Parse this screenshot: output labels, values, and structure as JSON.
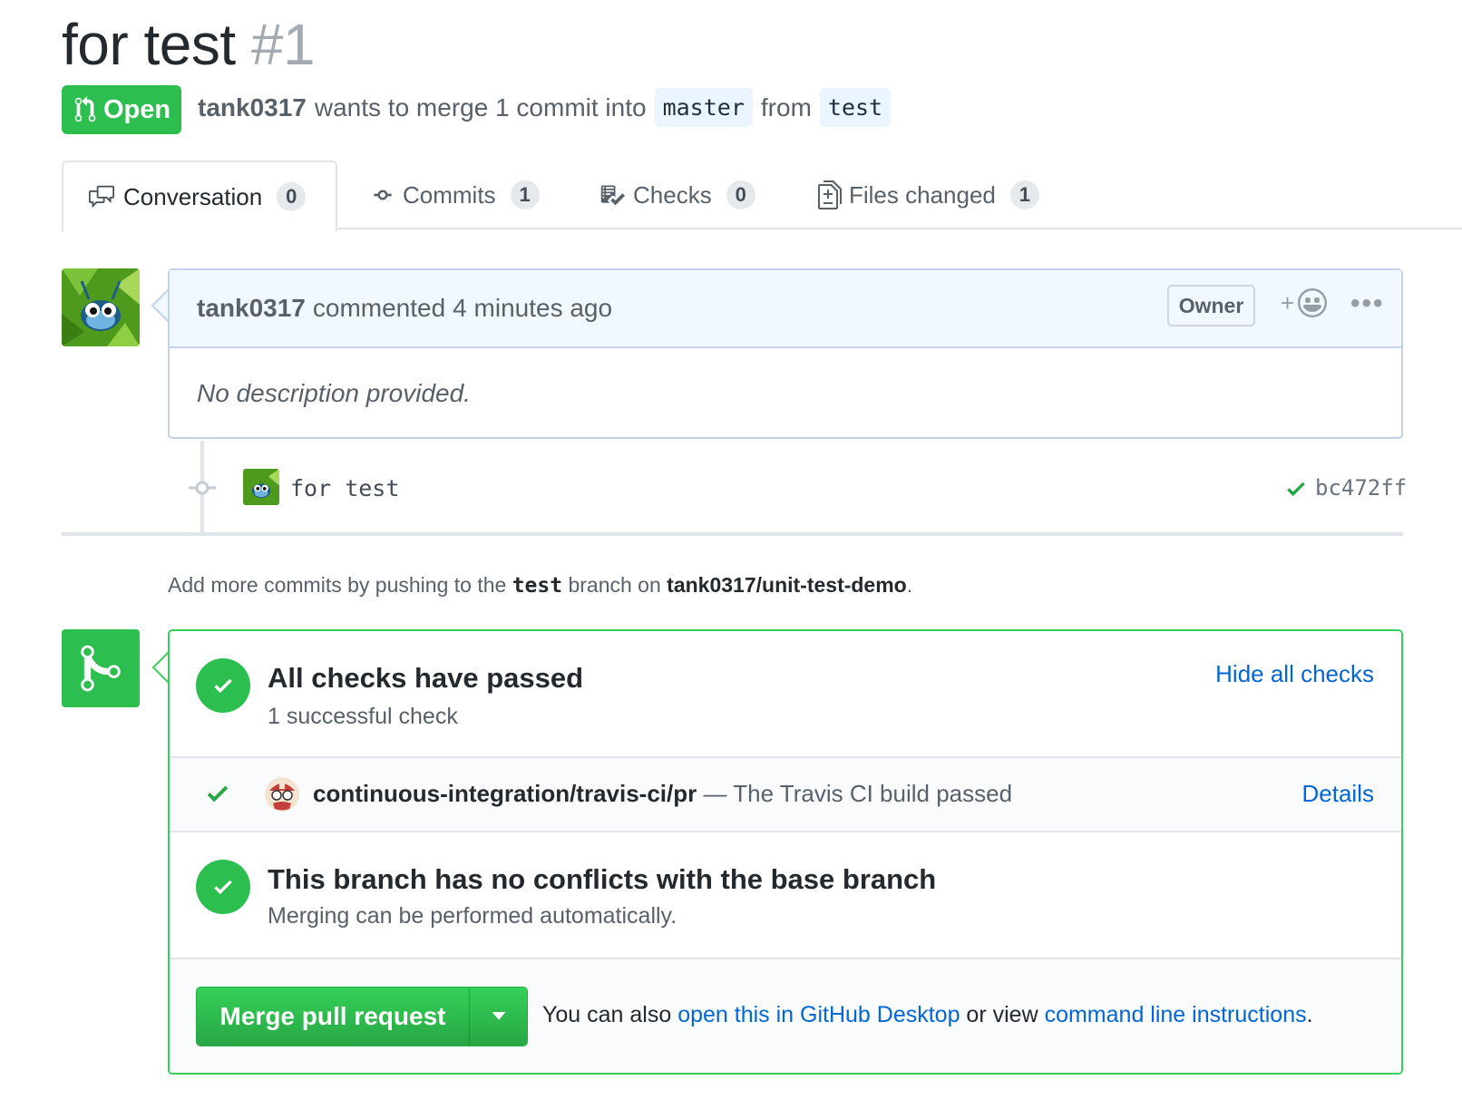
{
  "pr": {
    "title": "for test",
    "number": "#1",
    "state": "Open",
    "author": "tank0317",
    "summary": "wants to merge 1 commit into",
    "base_branch": "master",
    "from_word": "from",
    "head_branch": "test"
  },
  "tabs": [
    {
      "label": "Conversation",
      "count": "0",
      "icon": "conversation-icon",
      "selected": true
    },
    {
      "label": "Commits",
      "count": "1",
      "icon": "commit-icon"
    },
    {
      "label": "Checks",
      "count": "0",
      "icon": "checklist-icon"
    },
    {
      "label": "Files changed",
      "count": "1",
      "icon": "file-diff-icon"
    }
  ],
  "comment": {
    "author": "tank0317",
    "action": "commented",
    "time": "4 minutes ago",
    "role_label": "Owner",
    "reaction_plus": "+",
    "more": "•••",
    "body": "No description provided."
  },
  "commit": {
    "message": "for test",
    "sha": "bc472ff",
    "status": "success"
  },
  "push_hint": {
    "prefix": "Add more commits by pushing to the",
    "branch": "test",
    "middle": "branch on",
    "repo": "tank0317/unit-test-demo",
    "suffix": "."
  },
  "merge_box": {
    "checks_title": "All checks have passed",
    "checks_sub": "1 successful check",
    "hide_checks": "Hide all checks",
    "check_context": "continuous-integration/travis-ci/pr",
    "check_desc": " — The Travis CI build passed",
    "details": "Details",
    "conflicts_title": "This branch has no conflicts with the base branch",
    "conflicts_sub": "Merging can be performed automatically.",
    "merge_button": "Merge pull request",
    "also_prefix": "You can also ",
    "desktop_link": "open this in GitHub Desktop",
    "also_middle": " or view ",
    "cli_link": "command line instructions",
    "also_suffix": "."
  },
  "colors": {
    "green": "#2cbe4e",
    "link_blue": "#0366d6",
    "header_blue_bg": "#f1f8ff",
    "border_blue": "#c0d3eb"
  }
}
